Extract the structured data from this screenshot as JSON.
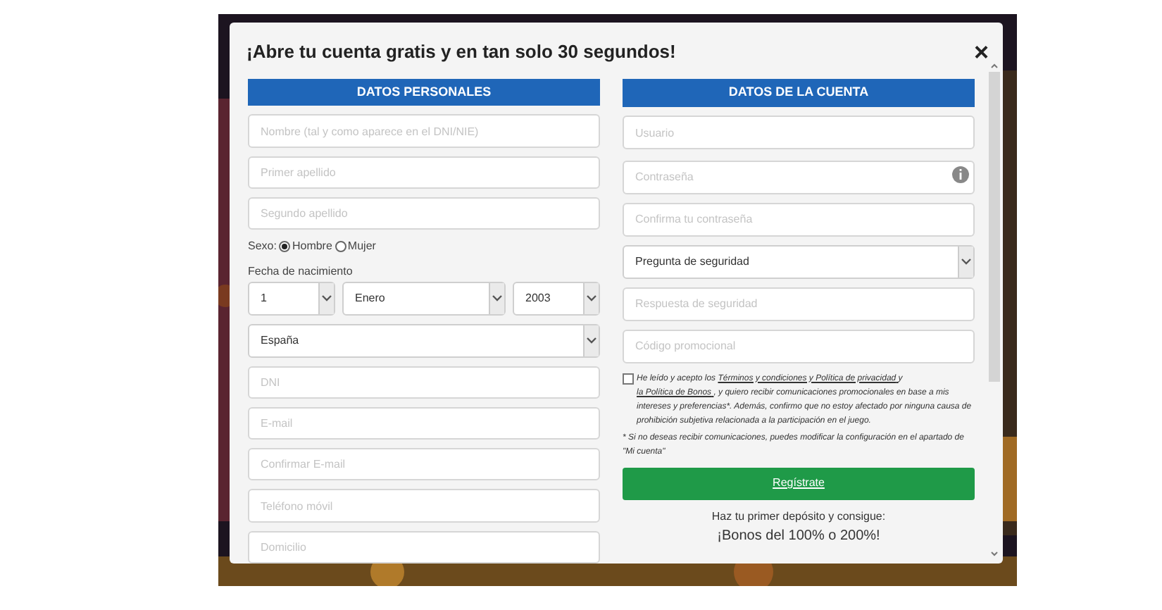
{
  "title": "¡Abre tu cuenta gratis y en tan solo 30 segundos!",
  "close": "×",
  "left": {
    "heading": "DATOS PERSONALES",
    "items": [
      {
        "kind": "input",
        "placeholder": "Nombre (tal y como aparece en el DNI/NIE)"
      },
      {
        "kind": "input",
        "placeholder": "Primer apellido"
      },
      {
        "kind": "input",
        "placeholder": "Segundo apellido"
      },
      {
        "kind": "radio",
        "label": "Sexo:",
        "options": [
          {
            "label": "Hombre",
            "selected": true
          },
          {
            "label": "Mujer",
            "selected": false
          }
        ]
      },
      {
        "kind": "date",
        "label": "Fecha de nacimiento",
        "values": [
          "1",
          "Enero",
          "2003"
        ]
      },
      {
        "kind": "select",
        "value": "España"
      },
      {
        "kind": "input",
        "placeholder": "DNI"
      },
      {
        "kind": "input",
        "placeholder": "E-mail"
      },
      {
        "kind": "input",
        "placeholder": "Confirmar E-mail"
      },
      {
        "kind": "input",
        "placeholder": "Teléfono móvil"
      },
      {
        "kind": "input",
        "placeholder": "Domicilio"
      }
    ]
  },
  "right": {
    "heading": "DATOS DE LA CUENTA",
    "items": [
      {
        "kind": "input",
        "placeholder": "Usuario"
      },
      {
        "kind": "password",
        "placeholder": "Contraseña"
      },
      {
        "kind": "input",
        "placeholder": "Confirma tu contraseña"
      },
      {
        "kind": "select",
        "value": "Pregunta de seguridad"
      },
      {
        "kind": "input",
        "placeholder": "Respuesta de seguridad"
      },
      {
        "kind": "input",
        "placeholder": "Código promocional"
      }
    ]
  },
  "consent": {
    "checked": false,
    "parts": [
      {
        "kind": "text",
        "text": "He leído y acepto los"
      },
      {
        "kind": "link",
        "text": "Términos y condiciones y Política de privacidad"
      },
      {
        "kind": "text",
        "text": "y"
      },
      {
        "kind": "link",
        "text": "la Política de Bonos"
      },
      {
        "kind": "text",
        "text": ", y quiero recibir comunicaciones promocionales en base a mis intereses y preferencias*. Además, confirmo que no estoy afectado por ninguna causa de prohibición subjetiva relacionada a la participación en el juego."
      }
    ]
  },
  "note": "* Si no deseas recibir comunicaciones, puedes modificar la configuración en el apartado de \"Mi cuenta\"",
  "register": "Regístrate",
  "promo": [
    "Haz tu primer depósito y consigue:",
    "¡Bonos del 100% o 200%!"
  ]
}
